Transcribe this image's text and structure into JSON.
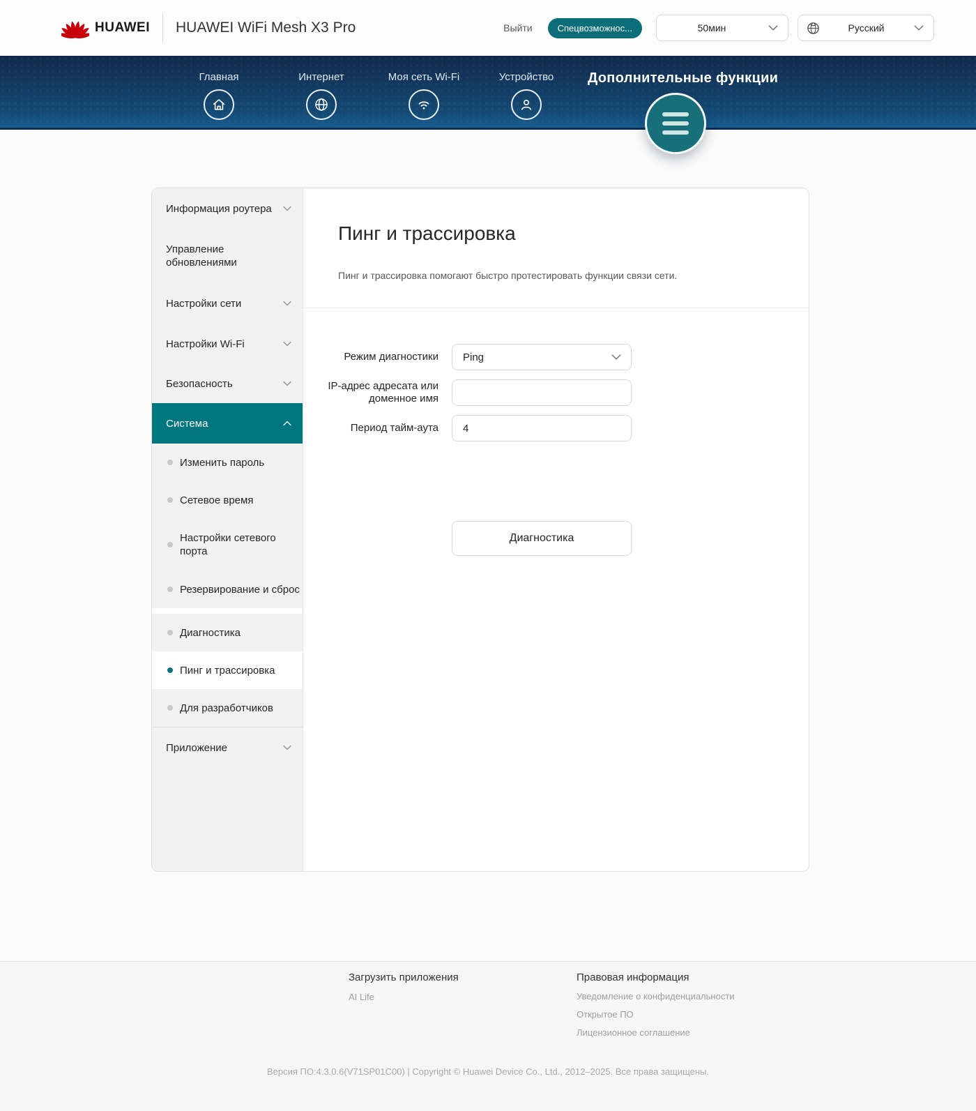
{
  "header": {
    "brand": "HUAWEI",
    "product": "HUAWEI WiFi Mesh X3 Pro",
    "logout_label": "Выйти",
    "accessibility_label": "Спецвозможнос...",
    "session_timeout": "50мин",
    "language": "Русский"
  },
  "nav": {
    "items": [
      {
        "label": "Главная",
        "icon": "home-icon"
      },
      {
        "label": "Интернет",
        "icon": "globe-icon"
      },
      {
        "label": "Моя сеть Wi-Fi",
        "icon": "wifi-icon"
      },
      {
        "label": "Устройство",
        "icon": "person-icon"
      }
    ],
    "more_label": "Дополнительные функции",
    "more_icon": "hamburger-menu-icon"
  },
  "sidebar": {
    "active_section": "Система",
    "active_item": "Пинг и трассировка",
    "items": [
      {
        "label": "Информация роутера"
      },
      {
        "label": "Управление обновлениями"
      },
      {
        "label": "Настройки сети"
      },
      {
        "label": "Настройки Wi-Fi"
      },
      {
        "label": "Безопасность"
      },
      {
        "label": "Система"
      },
      {
        "label": "Изменить пароль"
      },
      {
        "label": "Сетевое время"
      },
      {
        "label": "Настройки сетевого порта"
      },
      {
        "label": "Резервирование и сброс"
      },
      {
        "label": "Диагностика"
      },
      {
        "label": "Пинг и трассировка"
      },
      {
        "label": "Для разработчиков"
      },
      {
        "label": "Приложение"
      }
    ]
  },
  "content": {
    "title": "Пинг и трассировка",
    "description": "Пинг и трассировка помогают быстро протестировать функции связи сети.",
    "form": {
      "mode_label": "Режим диагностики",
      "mode_value": "Ping",
      "ip_label": "IP-адрес адресата или доменное имя",
      "ip_value": "",
      "timeout_label": "Период тайм-аута",
      "timeout_value": "4",
      "submit_label": "Диагностика"
    }
  },
  "footer": {
    "apps_heading": "Загрузить приложения",
    "apps_links": [
      "AI Life"
    ],
    "legal_heading": "Правовая информация",
    "legal_links": [
      "Уведомление о конфиденциальности",
      "Открытое ПО",
      "Лицензионное соглашение"
    ],
    "version": "Версия ПО:4.3.0.6(V71SP01C00) | Copyright © Huawei Device Co., Ltd., 2012–2025. Все права защищены."
  },
  "colors": {
    "accent_teal": "#00767f",
    "fab_teal": "#176f79",
    "logo_red": "#c7000b",
    "nav_gradient_top": "#12294a",
    "nav_gradient_bottom": "#175c8e",
    "sidebar_bg": "#f2f2f2"
  }
}
